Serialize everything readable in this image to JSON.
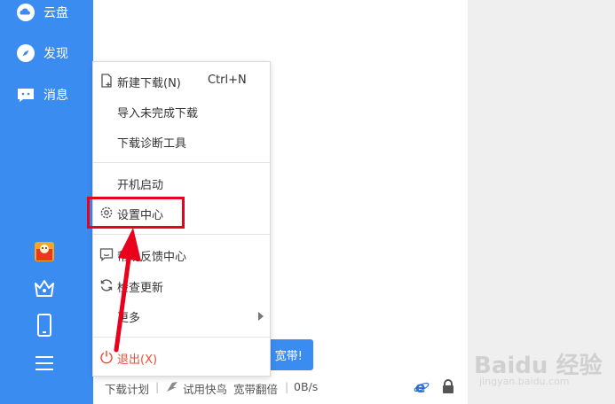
{
  "sidebar": {
    "items": [
      {
        "label": "云盘",
        "icon": "cloud-icon"
      },
      {
        "label": "发现",
        "icon": "compass-icon"
      },
      {
        "label": "消息",
        "icon": "message-icon"
      }
    ],
    "bottom_icons": [
      "gift-icon",
      "crown-icon",
      "phone-icon",
      "menu-icon"
    ]
  },
  "promo": {
    "label": "宽带!"
  },
  "statusbar": {
    "plan": "下载计划",
    "divider": "|",
    "trial": "试用快鸟",
    "boost": "宽带翻倍",
    "speed": "0B/s"
  },
  "menu": {
    "new_download": "新建下载(N)",
    "new_download_shortcut": "Ctrl+N",
    "import_unfinished": "导入未完成下载",
    "diagnostic_tool": "下载诊断工具",
    "startup": "开机启动",
    "settings": "设置中心",
    "feedback": "帮助反馈中心",
    "check_update": "检查更新",
    "more": "更多",
    "exit": "退出(X)"
  },
  "watermark": {
    "text": "Baidu 经验",
    "sub": "jingyan.baidu.com"
  },
  "colors": {
    "accent": "#3b8cf1",
    "highlight": "#e8001c",
    "exit": "#e8503a"
  }
}
